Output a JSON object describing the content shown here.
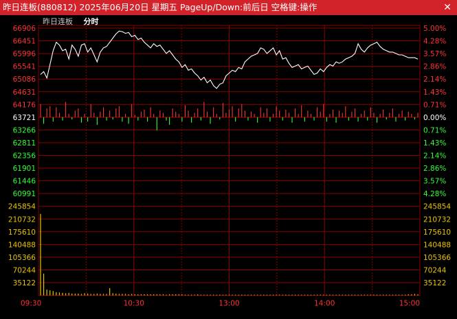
{
  "window": {
    "title": "昨日连板(880812) 2025年06月20日 星期五 PageUp/Down:前后日 空格键:操作",
    "close_glyph": "✕"
  },
  "toolbar": {
    "name_label": "昨日连板",
    "period_label": "分时"
  },
  "colors": {
    "up": "#ff3333",
    "down": "#33ff33",
    "neutral": "#ffffff",
    "volume_axis": "#e8c400",
    "grid": "#8b0000",
    "price_line": "#ffffff"
  },
  "chart_data": {
    "type": "line",
    "price_axis": {
      "left_ticks": [
        "66906",
        "66451",
        "65996",
        "65541",
        "65086",
        "64631",
        "64176",
        "63721",
        "63266",
        "62811",
        "62356",
        "61901",
        "61446",
        "60991"
      ],
      "right_ticks": [
        "5.00%",
        "4.28%",
        "3.57%",
        "2.86%",
        "2.14%",
        "1.43%",
        "0.71%",
        "0.00%",
        "0.71%",
        "1.43%",
        "2.14%",
        "2.86%",
        "3.57%",
        "4.28%"
      ],
      "reference": 63721,
      "range": [
        60991,
        66906
      ]
    },
    "volume_axis": {
      "left_ticks": [
        "245854",
        "210732",
        "175610",
        "140488",
        "105366",
        "70244",
        "35122"
      ],
      "right_ticks": [
        "245854",
        "210732",
        "175610",
        "140488",
        "105366",
        "70244",
        "35122"
      ],
      "range": [
        0,
        245854
      ]
    },
    "x_ticks": [
      "09:30",
      "10:30",
      "13:00",
      "14:00",
      "15:00"
    ],
    "price_series": {
      "x": [
        0,
        2,
        4,
        6,
        8,
        10,
        12,
        14,
        16,
        18,
        20,
        22,
        24,
        26,
        28,
        30,
        32,
        34,
        36,
        38,
        40,
        42,
        44,
        46,
        48,
        50,
        52,
        54,
        56,
        58,
        60,
        62,
        64,
        66,
        68,
        70,
        72,
        74,
        76,
        78,
        80,
        82,
        84,
        86,
        88,
        90,
        92,
        94,
        96,
        98,
        100,
        102,
        104,
        106,
        108,
        110,
        112,
        114,
        116,
        118,
        120,
        122,
        124,
        126,
        128,
        130,
        132,
        134,
        136,
        138,
        140,
        142,
        144,
        146,
        148,
        150,
        152,
        154,
        156,
        158,
        160,
        162,
        164,
        166,
        168,
        170,
        172,
        174,
        176,
        178,
        180,
        182,
        184,
        186,
        188,
        190,
        192,
        194,
        196,
        198,
        200,
        202,
        204,
        206,
        208,
        210,
        212,
        214,
        216,
        218,
        220,
        222,
        224,
        226,
        228,
        230,
        232,
        234,
        236,
        238,
        240
      ],
      "y": [
        65250,
        65350,
        65120,
        65600,
        66100,
        66400,
        66300,
        66100,
        66150,
        65800,
        66300,
        66150,
        65900,
        66300,
        66350,
        66050,
        66200,
        65950,
        65700,
        66050,
        66200,
        66250,
        66400,
        66550,
        66700,
        66800,
        66780,
        66720,
        66750,
        66600,
        66650,
        66500,
        66550,
        66400,
        66300,
        66200,
        66350,
        66250,
        66300,
        66150,
        66000,
        66100,
        65950,
        65800,
        65700,
        65500,
        65600,
        65400,
        65450,
        65300,
        65200,
        65050,
        65150,
        64950,
        65050,
        64850,
        64750,
        64900,
        64950,
        65200,
        65300,
        65400,
        65350,
        65500,
        65450,
        65700,
        65800,
        65900,
        65950,
        66000,
        66200,
        66150,
        66000,
        66100,
        66200,
        65950,
        66100,
        65800,
        65850,
        65650,
        65500,
        65550,
        65600,
        65450,
        65500,
        65550,
        65400,
        65250,
        65300,
        65450,
        65350,
        65500,
        65600,
        65550,
        65700,
        65650,
        65700,
        65800,
        65850,
        65900,
        66000,
        66350,
        66150,
        66050,
        66200,
        66300,
        66350,
        66400,
        66250,
        66150,
        66100,
        66050,
        66050,
        66000,
        65950,
        65950,
        65900,
        65850,
        65850,
        65850,
        65800
      ]
    },
    "volume_series": [
      225000,
      60000,
      16000,
      14000,
      12000,
      9000,
      8000,
      7000,
      6000,
      7000,
      5000,
      5000,
      5000,
      4000,
      6000,
      5000,
      4000,
      4000,
      5000,
      4000,
      4000,
      4000,
      20000,
      6000,
      5000,
      4000,
      4000,
      4000,
      3000,
      4000,
      3000,
      3000,
      3000,
      3000,
      3000,
      3000,
      3000,
      3000,
      3000,
      3000,
      2000,
      3000,
      3000,
      3000,
      3000,
      3000,
      2000,
      2000,
      2000,
      2000,
      3000,
      2000,
      2000,
      2000,
      2000,
      2000,
      2000,
      2000,
      2000,
      2000,
      2000,
      2000,
      2000,
      2000,
      2000,
      2000,
      2000,
      2000,
      2000,
      2000,
      2000,
      2000,
      2000,
      2000,
      2000,
      2000,
      2000,
      2000,
      2000,
      2000,
      2000,
      2000,
      2000,
      2000,
      2000,
      2000,
      2000,
      2000,
      2000,
      2000,
      2000,
      2000,
      2000,
      2000,
      2000,
      2000,
      2000,
      2000,
      2000,
      2000,
      2000,
      2000,
      2000,
      2000,
      2000,
      2000,
      2000,
      2000,
      2000,
      2000,
      2000,
      2000,
      2000,
      2000,
      2000,
      2000,
      2000,
      3000,
      3000,
      4000,
      3000
    ],
    "breadth_series": [
      12,
      -6,
      8,
      10,
      -4,
      9,
      4,
      -3,
      14,
      3,
      -2,
      6,
      8,
      -5,
      3,
      -4,
      12,
      4,
      -7,
      5,
      9,
      -3,
      6,
      -2,
      8,
      10,
      -4,
      3,
      -6,
      12,
      2,
      -3,
      5,
      7,
      -4,
      9,
      3,
      -12,
      6,
      4,
      -3,
      -7,
      8,
      5,
      3,
      -4,
      11,
      6,
      -5,
      4,
      8,
      -3,
      14,
      5,
      -6,
      9,
      3,
      -2,
      13,
      4,
      7,
      10,
      -4,
      8,
      12,
      6,
      -3,
      5,
      3,
      -5,
      9,
      4,
      8,
      -4,
      3,
      10,
      6,
      -3,
      7,
      4,
      -5,
      8,
      3,
      11,
      -4,
      6,
      3,
      -3,
      9,
      5,
      12,
      -4,
      3,
      7,
      -5,
      6,
      4,
      10,
      -3,
      5,
      8,
      -4,
      3,
      6,
      -3,
      9,
      4,
      -5,
      3,
      7,
      -2,
      4,
      8,
      -4,
      3,
      6,
      -3,
      5,
      3,
      -2,
      4
    ]
  }
}
